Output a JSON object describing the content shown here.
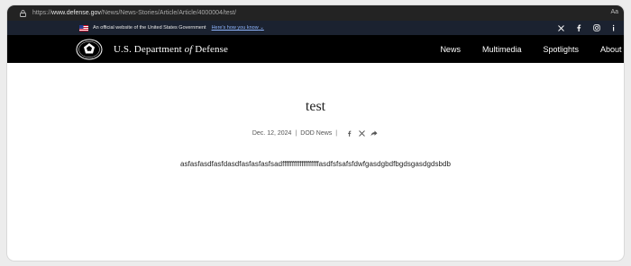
{
  "browser": {
    "url_prefix": "https://",
    "url_domain": "www.defense.gov",
    "url_path": "/News/News-Stories/Article/Article/4000004/test/",
    "reader_label": "Aa"
  },
  "gov_banner": {
    "text": "An official website of the United States Government",
    "link": "Here's how you know"
  },
  "social_icons": [
    "x-icon",
    "facebook-icon",
    "instagram-icon",
    "linkedin-icon"
  ],
  "header": {
    "dept_prefix": "U.S. Department ",
    "dept_of": "of",
    "dept_suffix": " Defense",
    "nav": [
      "News",
      "Multimedia",
      "Spotlights",
      "About"
    ]
  },
  "article": {
    "title": "test",
    "date": "Dec. 12, 2024",
    "source": "DOD News",
    "body": "asfasfasdfasfdasdfasfasfasfsadfffffffffffffffffffasdfsfsafsfdwfgasdgbdfbgdsgasdgdsbdb"
  },
  "colors": {
    "gov_banner_bg": "#1b2230",
    "nav_bg": "#000000",
    "link": "#8fb6ff"
  }
}
